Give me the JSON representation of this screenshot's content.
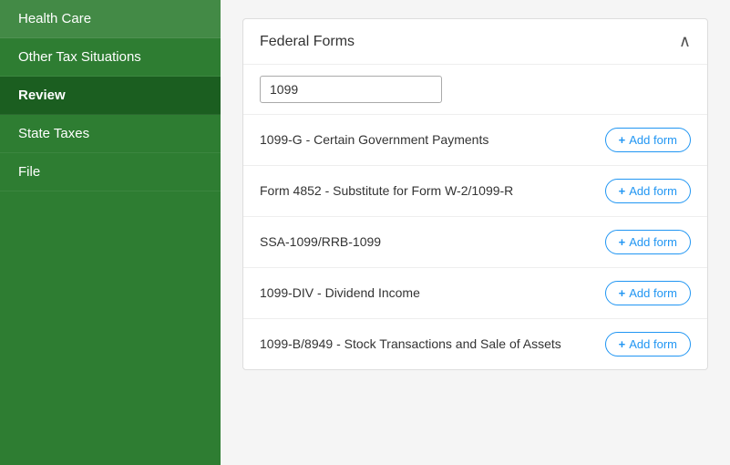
{
  "sidebar": {
    "items": [
      {
        "id": "health-care",
        "label": "Health Care",
        "active": false
      },
      {
        "id": "other-tax-situations",
        "label": "Other Tax Situations",
        "active": false
      },
      {
        "id": "review",
        "label": "Review",
        "active": true
      },
      {
        "id": "state-taxes",
        "label": "State Taxes",
        "active": false
      },
      {
        "id": "file",
        "label": "File",
        "active": false
      }
    ]
  },
  "main": {
    "card_title": "Federal Forms",
    "search_value": "1099",
    "search_placeholder": "",
    "forms": [
      {
        "id": "1099-g",
        "label": "1099-G - Certain Government Payments",
        "button": "+ Add form"
      },
      {
        "id": "form-4852",
        "label": "Form 4852 - Substitute for Form W-2/1099-R",
        "button": "+ Add form"
      },
      {
        "id": "ssa-1099",
        "label": "SSA-1099/RRB-1099",
        "button": "+ Add form"
      },
      {
        "id": "1099-div",
        "label": "1099-DIV - Dividend Income",
        "button": "+ Add form"
      },
      {
        "id": "1099-b",
        "label": "1099-B/8949 - Stock Transactions and Sale of Assets",
        "button": "+ Add form"
      }
    ],
    "chevron": "∧"
  }
}
